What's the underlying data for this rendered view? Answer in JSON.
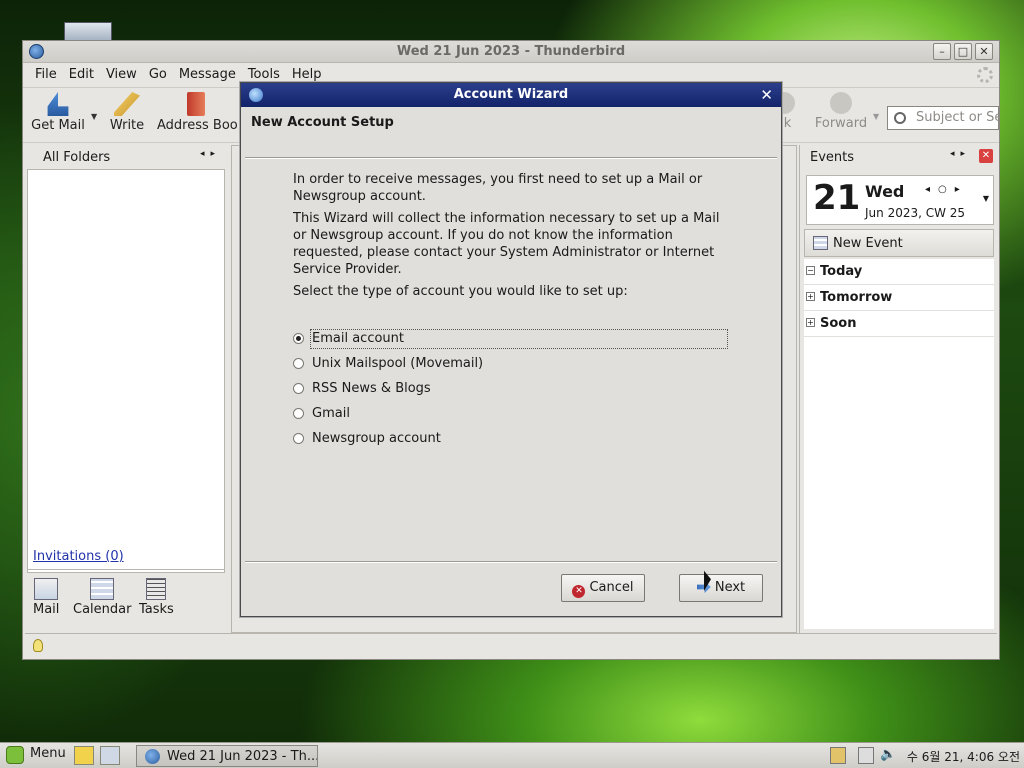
{
  "window": {
    "title": "Wed 21 Jun 2023 - Thunderbird"
  },
  "menubar": [
    "File",
    "Edit",
    "View",
    "Go",
    "Message",
    "Tools",
    "Help"
  ],
  "toolbar": {
    "get_mail": "Get Mail",
    "write": "Write",
    "address_book": "Address Boo",
    "back": "ck",
    "forward": "Forward",
    "search_placeholder": "Subject or Se"
  },
  "folder_pane": {
    "header": "All Folders",
    "invitations": "Invitations (0)"
  },
  "modes": [
    "Mail",
    "Calendar",
    "Tasks"
  ],
  "events_pane": {
    "header": "Events",
    "day": "21",
    "weekday": "Wed",
    "sub": "Jun 2023, CW 25",
    "new_event": "New Event",
    "agenda": [
      "Today",
      "Tomorrow",
      "Soon"
    ]
  },
  "dialog": {
    "title": "Account Wizard",
    "heading": "New Account Setup",
    "para1": "In order to receive messages, you first need to set up a Mail or Newsgroup account.",
    "para2": "This Wizard will collect the information necessary to set up a Mail or Newsgroup account. If you do not know the information requested, please contact your System Administrator or Internet Service Provider.",
    "para3": "Select the type of account you would like to set up:",
    "options": [
      "Email account",
      "Unix Mailspool (Movemail)",
      "RSS News & Blogs",
      "Gmail",
      "Newsgroup account"
    ],
    "selected_index": 0,
    "cancel": "Cancel",
    "next": "Next"
  },
  "taskbar": {
    "menu": "Menu",
    "task": "Wed 21 Jun 2023 - Th...",
    "clock": "수 6월 21, 4:06 오전"
  }
}
